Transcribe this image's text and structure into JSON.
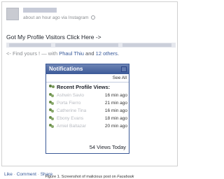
{
  "post": {
    "meta_text": "about an hour ago via Instagram",
    "headline": "Got My Profile Visitors Click Here ->",
    "find_prefix": "<- Find yours ! — with ",
    "tagged_person": "Phaul Thiu",
    "and_text": " and ",
    "others_text": "12 others",
    "others_suffix": "."
  },
  "notifications": {
    "title": "Notifications",
    "see_all": "See All",
    "section_title": "Recent Profile Views:",
    "viewers": [
      {
        "name": "Ashwin Savio",
        "time": "16 min ago"
      },
      {
        "name": "Porta Fierro",
        "time": "21 min ago"
      },
      {
        "name": "Catherine Tina",
        "time": "16 min ago"
      },
      {
        "name": "Ebony Evans",
        "time": "18 min ago"
      },
      {
        "name": "Amiel Baltazar",
        "time": "20 min ago"
      }
    ],
    "views_today": "54 Views Today"
  },
  "actions": {
    "like": "Like",
    "comment": "Comment",
    "share": "Share",
    "separator": "·"
  },
  "caption": {
    "prefix": "Figure 1. Screenshot of malicious post on ",
    "site": "Facebook"
  },
  "colors": {
    "link": "#365899",
    "header_blue": "#3b5998"
  }
}
